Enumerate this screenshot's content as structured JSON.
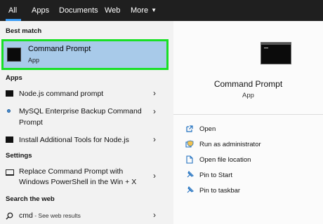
{
  "tabs": [
    {
      "label": "All"
    },
    {
      "label": "Apps"
    },
    {
      "label": "Documents"
    },
    {
      "label": "Web"
    },
    {
      "label": "More"
    }
  ],
  "sections": {
    "best_match": "Best match",
    "apps": "Apps",
    "settings": "Settings",
    "search_web": "Search the web"
  },
  "best_match": {
    "title": "Command Prompt",
    "subtitle": "App"
  },
  "apps": [
    {
      "line1": "Node.js command prompt",
      "line2": "",
      "icon": "cmd-icon"
    },
    {
      "line1": "MySQL Enterprise Backup Command",
      "line2": "Prompt",
      "icon": "mysql-icon"
    },
    {
      "line1": "Install Additional Tools for Node.js",
      "line2": "",
      "icon": "cmd-icon"
    }
  ],
  "settings_item": {
    "line1": "Replace Command Prompt with",
    "line2": "Windows PowerShell in the Win + X",
    "icon": "monitor-icon"
  },
  "web_item": {
    "query": "cmd",
    "suffix": " - See web results",
    "icon": "search-icon"
  },
  "preview": {
    "title": "Command Prompt",
    "subtitle": "App"
  },
  "actions": [
    {
      "label": "Open",
      "icon": "open-icon"
    },
    {
      "label": "Run as administrator",
      "icon": "admin-shield-icon"
    },
    {
      "label": "Open file location",
      "icon": "file-location-icon"
    },
    {
      "label": "Pin to Start",
      "icon": "pin-icon"
    },
    {
      "label": "Pin to taskbar",
      "icon": "pin-taskbar-icon"
    }
  ],
  "colors": {
    "highlight": "#a8cae9",
    "highlight_border": "#18e025",
    "accent": "#3a9bf4",
    "topbar": "#1f1f1f"
  }
}
